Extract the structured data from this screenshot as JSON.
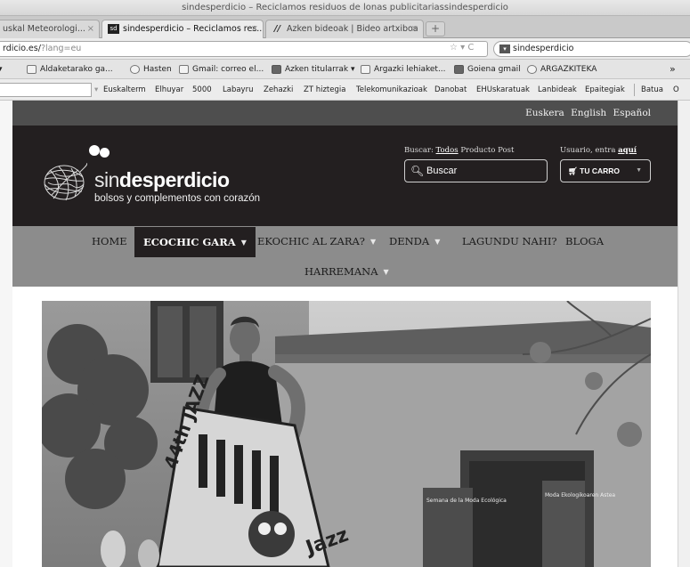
{
  "window": {
    "title": "sindesperdicio – Reciclamos residuos de lonas publicitariassindesperdicio"
  },
  "tabs": [
    {
      "label": "uskal Meteorologi...",
      "active": false
    },
    {
      "label": "sindesperdicio – Reciclamos res...",
      "favicon": "sd",
      "active": true
    },
    {
      "label": "Azken bideoak | Bideo artxiboa",
      "favicon": "//",
      "active": false
    }
  ],
  "tab_close": "×",
  "new_tab": "+",
  "address": {
    "url": "rdicio.es/",
    "url_tail": "?lang=eu",
    "icons": "☆ ▾ C",
    "search_value": "sindesperdicio"
  },
  "bookmarks": [
    {
      "label": "▾"
    },
    {
      "label": "Aldaketarako ga..."
    },
    {
      "label": "Hasten"
    },
    {
      "label": "Gmail: correo el..."
    },
    {
      "label": "Azken titularrak ▾"
    },
    {
      "label": "Argazki lehiaket..."
    },
    {
      "label": "Goiena gmail"
    },
    {
      "label": "ARGAZKITEKA"
    },
    {
      "label": "»"
    }
  ],
  "toolbar2": {
    "links": [
      "Euskalterm",
      "Elhuyar",
      "5000",
      "Labayru",
      "Zehazki",
      "ZT hiztegia",
      "Telekomunikazioak",
      "Danobat",
      "EHUskaratuak",
      "Lanbideak",
      "Epaitegiak",
      "Batua",
      "O"
    ]
  },
  "site": {
    "languages": [
      "Euskera",
      "English",
      "Español"
    ],
    "logo": {
      "prefix": "sin",
      "main": "desperdicio",
      "tagline": "bolsos y complementos con corazón"
    },
    "search": {
      "label_prefix": "Buscar:",
      "option_todos": "Todos",
      "option_producto": "Producto",
      "option_post": "Post",
      "placeholder": "Buscar"
    },
    "user": {
      "label_prefix": "Usuario, entra",
      "link": "aquí"
    },
    "cart": {
      "label": "TU CARRO"
    },
    "menu": [
      {
        "label": "HOME",
        "active": false,
        "caret": false
      },
      {
        "label": "ECOCHIC GARA",
        "active": true,
        "caret": true
      },
      {
        "label": "EKOCHIC AL ZARA?",
        "active": false,
        "caret": true
      },
      {
        "label": "DENDA",
        "active": false,
        "caret": true
      },
      {
        "label": "LAGUNDU NAHI?",
        "active": false,
        "caret": false
      },
      {
        "label": "BLOGA",
        "active": false,
        "caret": false
      },
      {
        "label": "HARREMANA",
        "active": false,
        "caret": true
      }
    ],
    "hero": {
      "banner_text_1": "Semana de la Moda Ecológica",
      "banner_text_2": "Moda Ekologikoaren Astea",
      "bag_text_1": "44th JAZZ",
      "bag_text_2": "Jazz"
    }
  }
}
